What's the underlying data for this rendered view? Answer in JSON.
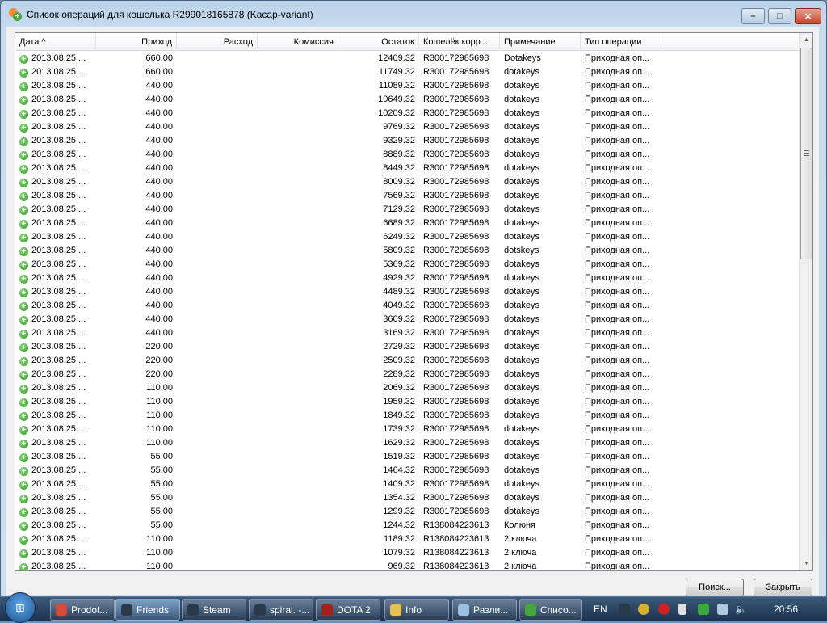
{
  "window": {
    "title": "Список операций для кошелька R299018165878 (Kacap-variant)",
    "minimize": "–",
    "maximize": "□",
    "close": "✕"
  },
  "columns": [
    "Дата ^",
    "Приход",
    "Расход",
    "Комиссия",
    "Остаток",
    "Кошелёк корр...",
    "Примечание",
    "Тип операции"
  ],
  "row_defaults": {
    "date": "2013.08.25 ...",
    "type": "Приходная оп..."
  },
  "rows": [
    [
      "660.00",
      "12409.32",
      "R300172985698",
      "Dotakeys"
    ],
    [
      "660.00",
      "11749.32",
      "R300172985698",
      "dotakeys"
    ],
    [
      "440.00",
      "11089.32",
      "R300172985698",
      "dotakeys"
    ],
    [
      "440.00",
      "10649.32",
      "R300172985698",
      "dotakeys"
    ],
    [
      "440.00",
      "10209.32",
      "R300172985698",
      "dotakeys"
    ],
    [
      "440.00",
      "9769.32",
      "R300172985698",
      "dotakeys"
    ],
    [
      "440.00",
      "9329.32",
      "R300172985698",
      "dotakeys"
    ],
    [
      "440.00",
      "8889.32",
      "R300172985698",
      "dotakeys"
    ],
    [
      "440.00",
      "8449.32",
      "R300172985698",
      "dotakeys"
    ],
    [
      "440.00",
      "8009.32",
      "R300172985698",
      "dotakeys"
    ],
    [
      "440.00",
      "7569.32",
      "R300172985698",
      "dotakeys"
    ],
    [
      "440.00",
      "7129.32",
      "R300172985698",
      "dotakeys"
    ],
    [
      "440.00",
      "6689.32",
      "R300172985698",
      "dotakeys"
    ],
    [
      "440.00",
      "6249.32",
      "R300172985698",
      "dotakeys"
    ],
    [
      "440.00",
      "5809.32",
      "R300172985698",
      "dotskeys"
    ],
    [
      "440.00",
      "5369.32",
      "R300172985698",
      "dotakeys"
    ],
    [
      "440.00",
      "4929.32",
      "R300172985698",
      "dotakeys"
    ],
    [
      "440.00",
      "4489.32",
      "R300172985698",
      "dotakeys"
    ],
    [
      "440.00",
      "4049.32",
      "R300172985698",
      "dotakeys"
    ],
    [
      "440.00",
      "3609.32",
      "R300172985698",
      "dotakeys"
    ],
    [
      "440.00",
      "3169.32",
      "R300172985698",
      "dotakeys"
    ],
    [
      "220.00",
      "2729.32",
      "R300172985698",
      "dotakeys"
    ],
    [
      "220.00",
      "2509.32",
      "R300172985698",
      "dotakeys"
    ],
    [
      "220.00",
      "2289.32",
      "R300172985698",
      "dotakeys"
    ],
    [
      "110.00",
      "2069.32",
      "R300172985698",
      "dotakeys"
    ],
    [
      "110.00",
      "1959.32",
      "R300172985698",
      "dotakeys"
    ],
    [
      "110.00",
      "1849.32",
      "R300172985698",
      "dotakeys"
    ],
    [
      "110.00",
      "1739.32",
      "R300172985698",
      "dotakeys"
    ],
    [
      "110.00",
      "1629.32",
      "R300172985698",
      "dotakeys"
    ],
    [
      "55.00",
      "1519.32",
      "R300172985698",
      "dotakeys"
    ],
    [
      "55.00",
      "1464.32",
      "R300172985698",
      "dotakeys"
    ],
    [
      "55.00",
      "1409.32",
      "R300172985698",
      "dotakeys"
    ],
    [
      "55.00",
      "1354.32",
      "R300172985698",
      "dotakeys"
    ],
    [
      "55.00",
      "1299.32",
      "R300172985698",
      "dotakeys"
    ],
    [
      "55.00",
      "1244.32",
      "R138084223613",
      "Колюня"
    ],
    [
      "110.00",
      "1189.32",
      "R138084223613",
      "2 ключа"
    ],
    [
      "110.00",
      "1079.32",
      "R138084223613",
      "2 ключа"
    ],
    [
      "110.00",
      "969.32",
      "R138084223613",
      "2 ключа"
    ]
  ],
  "buttons": {
    "search": "Поиск...",
    "close": "Закрыть"
  },
  "taskbar": {
    "items": [
      {
        "label": "Prodot...",
        "icon": "chrome-icon",
        "color": "#d9493a"
      },
      {
        "label": "Friends",
        "icon": "steam-icon",
        "color": "#2a3a4a",
        "active": true
      },
      {
        "label": "Steam",
        "icon": "steam-icon",
        "color": "#2a3a4a"
      },
      {
        "label": "spiral. -...",
        "icon": "steam-icon",
        "color": "#2a3a4a"
      },
      {
        "label": "DOTA 2",
        "icon": "dota-icon",
        "color": "#a0221a"
      },
      {
        "label": "Info",
        "icon": "folder-icon",
        "color": "#e8c050"
      },
      {
        "label": "Разли...",
        "icon": "notepad-icon",
        "color": "#9cc0e0"
      },
      {
        "label": "Списо...",
        "icon": "webmoney-icon",
        "color": "#44a83a"
      }
    ],
    "lang": "EN",
    "clock": "20:56"
  }
}
